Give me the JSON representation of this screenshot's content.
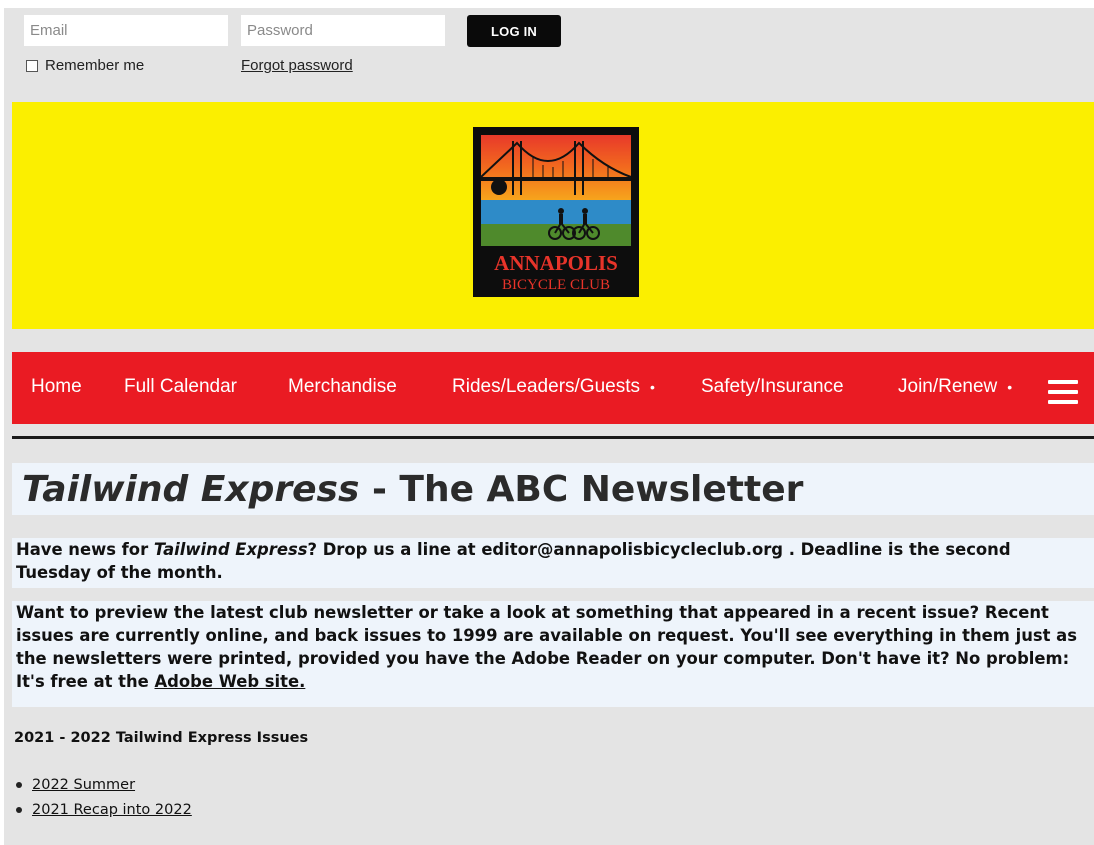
{
  "login": {
    "email_placeholder": "Email",
    "password_placeholder": "Password",
    "login_button": "LOG IN",
    "remember_label": "Remember me",
    "forgot_link": "Forgot password"
  },
  "banner": {
    "logo_line1": "ANNAPOLIS",
    "logo_line2": "BICYCLE CLUB"
  },
  "nav": {
    "items": [
      {
        "label": "Home"
      },
      {
        "label": "Full Calendar"
      },
      {
        "label": "Merchandise"
      },
      {
        "label": "Rides/Leaders/Guests",
        "dot": "•"
      },
      {
        "label": "Safety/Insurance"
      },
      {
        "label": "Join/Renew",
        "dot": "•"
      }
    ],
    "menu_icon": "hamburger-icon"
  },
  "content": {
    "title_italic": "Tailwind Express",
    "title_rest": " - The ABC Newsletter",
    "p1_lead": "Have news for ",
    "p1_italic": "Tailwind Express",
    "p1_rest": "? Drop us a line at editor@annapolisbicycleclub.org . Deadline is the second Tuesday of the month.",
    "p2_text": "Want to preview the latest club newsletter or take a look at something that appeared in a recent issue? Recent issues are currently online, and back issues to 1999 are available on request. You'll see everything in them just as the newsletters were printed, provided you have the Adobe Reader on your computer. Don't have it? No problem: It's free at the ",
    "p2_link": "Adobe Web site.",
    "issues_heading": "2021 - 2022 Tailwind Express Issues",
    "issues": [
      {
        "label": "2022 Summer"
      },
      {
        "label": "2021 Recap into 2022"
      }
    ]
  },
  "colors": {
    "banner": "#fbef00",
    "nav": "#ea1b23",
    "band": "#eef4fb"
  }
}
